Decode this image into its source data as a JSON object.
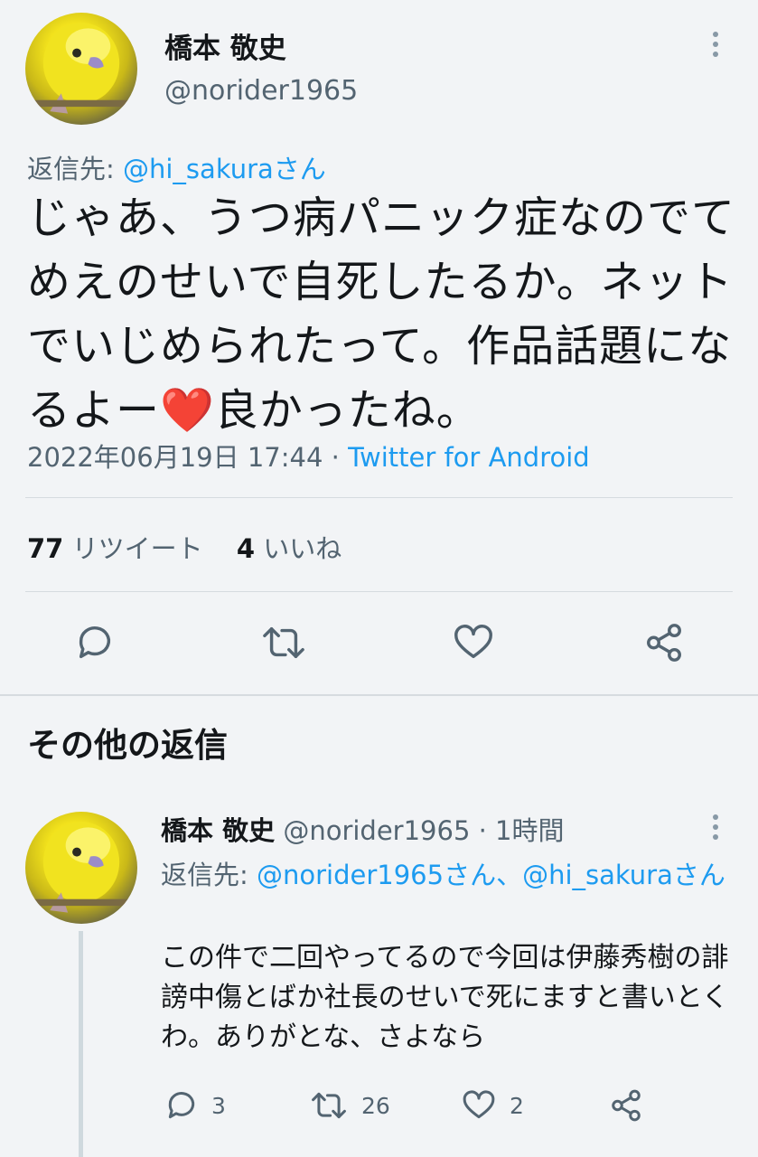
{
  "main_tweet": {
    "display_name": "橋本 敬史",
    "handle": "@norider1965",
    "reply_prefix": "返信先: ",
    "reply_to": "@hi_sakuraさん",
    "text": "じゃあ、うつ病パニック症なのでてめえのせいで自死したるか。ネットでいじめられたって。作品話題になるよー❤️良かったね。",
    "timestamp": "2022年06月19日 17:44",
    "separator": " · ",
    "source": "Twitter for Android",
    "retweets_count": "77",
    "retweets_label": "リツイート",
    "likes_count": "4",
    "likes_label": "いいね"
  },
  "section_title": "その他の返信",
  "reply_tweet": {
    "display_name": "橋本 敬史",
    "handle": "@norider1965",
    "time": "· 1時間",
    "reply_prefix": "返信先: ",
    "reply_to": "@norider1965さん、@hi_sakuraさん",
    "text": "この件で二回やってるので今回は伊藤秀樹の誹謗中傷とばか社長のせいで死にますと書いとくわ。ありがとな、さよなら",
    "replies": "3",
    "retweets": "26",
    "likes": "2"
  },
  "icons": {
    "more": "more-vertical-icon",
    "reply": "reply-bubble-icon",
    "retweet": "retweet-icon",
    "like": "heart-icon",
    "share": "share-icon"
  },
  "colors": {
    "link": "#1d9bf0",
    "secondary_text": "#536471",
    "background": "#f2f4f6"
  }
}
